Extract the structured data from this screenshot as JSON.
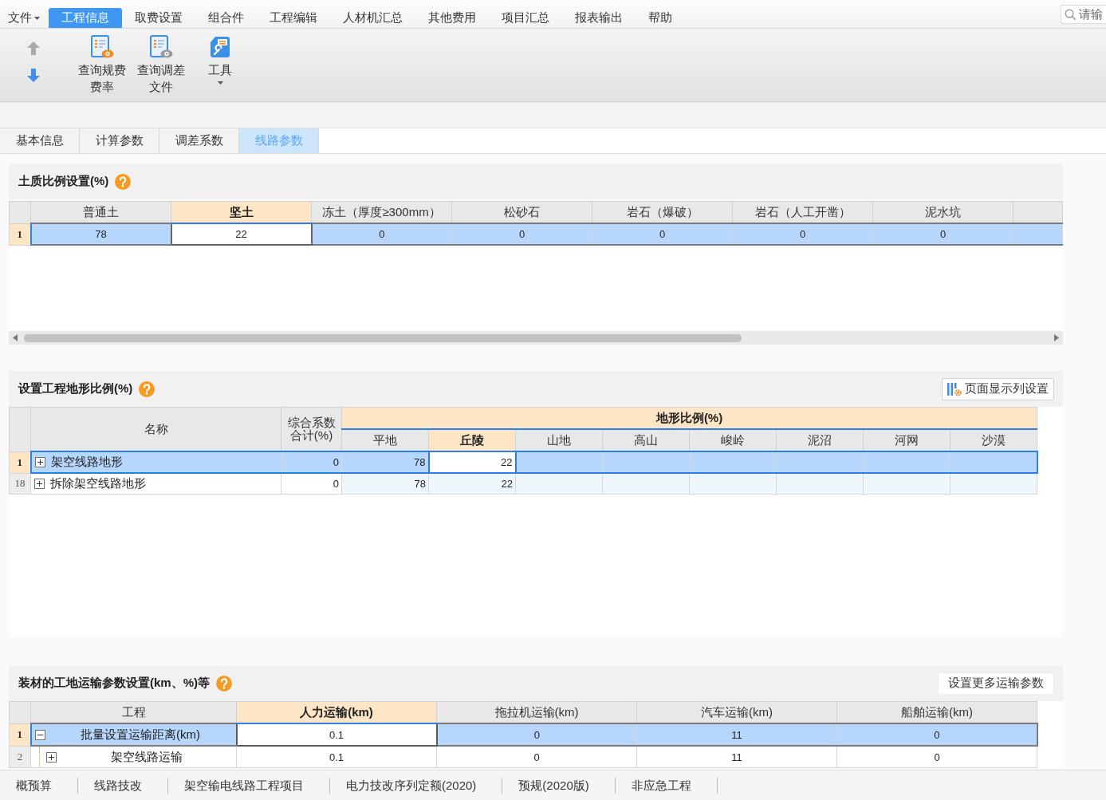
{
  "menu": {
    "items": [
      {
        "label": "文件",
        "kind": "dropdown",
        "selected": false
      },
      {
        "label": "工程信息",
        "kind": "tab",
        "selected": true
      },
      {
        "label": "取费设置",
        "kind": "tab",
        "selected": false
      },
      {
        "label": "组合件",
        "kind": "tab",
        "selected": false
      },
      {
        "label": "工程编辑",
        "kind": "tab",
        "selected": false
      },
      {
        "label": "人材机汇总",
        "kind": "tab",
        "selected": false
      },
      {
        "label": "其他费用",
        "kind": "tab",
        "selected": false
      },
      {
        "label": "项目汇总",
        "kind": "tab",
        "selected": false
      },
      {
        "label": "报表输出",
        "kind": "tab",
        "selected": false
      },
      {
        "label": "帮助",
        "kind": "tab",
        "selected": false
      }
    ],
    "search": {
      "placeholder": "请输"
    }
  },
  "toolbar": {
    "nav": [
      {
        "kind": "up",
        "disabled": true
      },
      {
        "kind": "down",
        "disabled": false
      }
    ],
    "buttons": [
      {
        "label": "查询规费费率",
        "kind": "plain"
      },
      {
        "label": "查询调差文件",
        "kind": "plain"
      },
      {
        "label": "工具",
        "kind": "dropdown"
      }
    ]
  },
  "tabs": [
    {
      "label": "基本信息",
      "selected": false
    },
    {
      "label": "计算参数",
      "selected": false
    },
    {
      "label": "调差系数",
      "selected": false
    },
    {
      "label": "线路参数",
      "selected": true
    }
  ],
  "soil": {
    "title": "土质比例设置(%)",
    "table": {
      "columns": [
        {
          "label": "普通土",
          "selected": false
        },
        {
          "label": "坚土",
          "selected": true
        },
        {
          "label": "冻土（厚度≥300mm）",
          "selected": false
        },
        {
          "label": "松砂石",
          "selected": false
        },
        {
          "label": "岩石（爆破）",
          "selected": false
        },
        {
          "label": "岩石（人工开凿）",
          "selected": false
        },
        {
          "label": "泥水坑",
          "selected": false
        }
      ],
      "rows": [
        {
          "number": "1",
          "selected": true,
          "cells": [
            "78",
            "22",
            "0",
            "0",
            "0",
            "0",
            "0"
          ]
        }
      ]
    }
  },
  "terrain": {
    "title": "设置工程地形比例(%)",
    "button": "页面显示列设置",
    "table": {
      "columns": [
        {
          "label": "名称",
          "selected": false
        },
        {
          "label": "综合系数合计(%)",
          "selected": false
        }
      ],
      "group": {
        "label": "地形比例(%)",
        "columns": [
          {
            "label": "平地",
            "selected": false
          },
          {
            "label": "丘陵",
            "selected": true
          },
          {
            "label": "山地",
            "selected": false
          },
          {
            "label": "高山",
            "selected": false
          },
          {
            "label": "峻岭",
            "selected": false
          },
          {
            "label": "泥沼",
            "selected": false
          },
          {
            "label": "河网",
            "selected": false
          },
          {
            "label": "沙漠",
            "selected": false
          }
        ]
      },
      "rows": [
        {
          "number": "1",
          "selected": true,
          "expanded": false,
          "name": "架空线路地形",
          "total": "0",
          "cells": [
            "78",
            "22"
          ]
        },
        {
          "number": "18",
          "selected": false,
          "expanded": false,
          "name": "拆除架空线路地形",
          "total": "0",
          "cells": [
            "78",
            "22"
          ]
        }
      ]
    }
  },
  "transport": {
    "title": "装材的工地运输参数设置(km、%)等",
    "button": "设置更多运输参数",
    "table": {
      "columns": [
        {
          "label": "工程",
          "selected": false
        },
        {
          "label": "人力运输(km)",
          "selected": true
        },
        {
          "label": "拖拉机运输(km)",
          "selected": false
        },
        {
          "label": "汽车运输(km)",
          "selected": false
        },
        {
          "label": "船舶运输(km)",
          "selected": false
        }
      ],
      "rows": [
        {
          "number": "1",
          "selected": true,
          "expanded": true,
          "cells": [
            "批量设置运输距离(km)",
            "0.1",
            "0",
            "11",
            "0"
          ],
          "children": [
            {
              "number": "2",
              "selected": false,
              "expanded": false,
              "cells": [
                "架空线路运输",
                "0.1",
                "0",
                "11",
                "0"
              ]
            }
          ]
        }
      ]
    }
  },
  "status_tabs": [
    "概预算",
    "线路技改",
    "架空输电线路工程项目",
    "电力技改序列定额(2020)",
    "预规(2020版)",
    "非应急工程"
  ]
}
